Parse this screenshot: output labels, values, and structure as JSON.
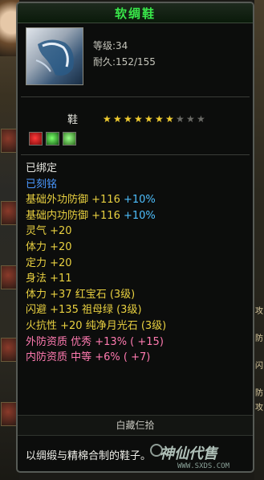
{
  "item": {
    "name": "软绸鞋",
    "level_label": "等级:34",
    "durability_label": "耐久:152/155",
    "slot": "鞋",
    "stars": {
      "filled": 7,
      "total": 10
    },
    "gems": [
      "red-gem-icon",
      "green-gem-icon",
      "green-gem-icon"
    ]
  },
  "stats": [
    {
      "text": "已绑定",
      "extra": "",
      "color": "white"
    },
    {
      "text": "已刻铭",
      "extra": "",
      "color": "blue"
    },
    {
      "text": "基础外功防御 +116",
      "extra": " +10%",
      "color": "yellow"
    },
    {
      "text": "基础内功防御 +116",
      "extra": " +10%",
      "color": "yellow"
    },
    {
      "text": "灵气 +20",
      "extra": "",
      "color": "yellow"
    },
    {
      "text": "体力 +20",
      "extra": "",
      "color": "yellow"
    },
    {
      "text": "定力 +20",
      "extra": "",
      "color": "yellow"
    },
    {
      "text": "身法 +11",
      "extra": "",
      "color": "yellow"
    },
    {
      "text": "体力 +37 红宝石 (3级)",
      "extra": "",
      "color": "yellow"
    },
    {
      "text": "闪避 +135 祖母绿 (3级)",
      "extra": "",
      "color": "yellow"
    },
    {
      "text": "火抗性 +20 纯净月光石 (3级)",
      "extra": "",
      "color": "yellow"
    },
    {
      "text": "外防资质  优秀 +13% ( +15)",
      "extra": "",
      "color": "pink"
    },
    {
      "text": "内防资质  中等 +6% ( +7)",
      "extra": "",
      "color": "pink"
    }
  ],
  "maker": "白藏仨拾",
  "description": "以绸缎与精棉合制的鞋子。",
  "watermark": {
    "text": "神仙代售",
    "url": "WWW.SXDS.COM"
  },
  "right_edge_chars": [
    "攻",
    "防",
    "闪",
    "防",
    "攻"
  ]
}
